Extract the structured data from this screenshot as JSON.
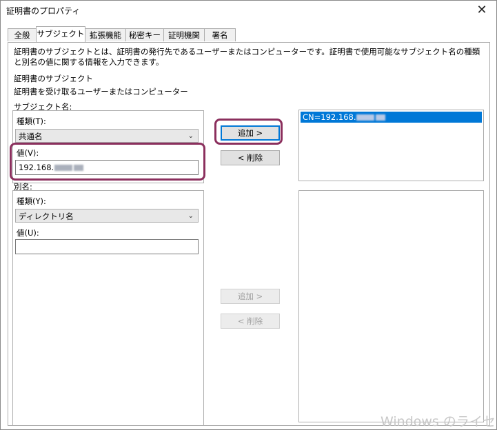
{
  "window": {
    "title": "証明書のプロパティ",
    "close_glyph": "✕"
  },
  "tabs": [
    {
      "label": "全般",
      "active": false
    },
    {
      "label": "サブジェクト",
      "active": true
    },
    {
      "label": "拡張機能",
      "active": false
    },
    {
      "label": "秘密キー",
      "active": false
    },
    {
      "label": "証明機関",
      "active": false
    },
    {
      "label": "署名",
      "active": false
    }
  ],
  "subject": {
    "description": "証明書のサブジェクトとは、証明書の発行先であるユーザーまたはコンピューターです。証明書で使用可能なサブジェクト名の種類と別名の値に関する情報を入力できます。",
    "heading": "証明書のサブジェクト",
    "subheading": "証明書を受け取るユーザーまたはコンピューター",
    "subject_name_label": "サブジェクト名:",
    "type_label": "種類(T):",
    "type_value": "共通名",
    "value_label": "値(V):",
    "value_text": "192.168.",
    "alt_name_label": "別名:",
    "alt_type_label": "種類(Y):",
    "alt_type_value": "ディレクトリ名",
    "alt_value_label": "値(U):",
    "alt_value_text": "",
    "add_button": "追加 >",
    "remove_button": "< 削除",
    "alt_add_button": "追加 >",
    "alt_remove_button": "< 削除",
    "selected_list_item": "CN=192.168."
  },
  "watermark": "Windows のライセンス",
  "colors": {
    "highlight": "#8b2f5d",
    "selection": "#0078d7"
  },
  "icons": {
    "close": "close-icon",
    "dropdown": "chevron-down-icon"
  }
}
